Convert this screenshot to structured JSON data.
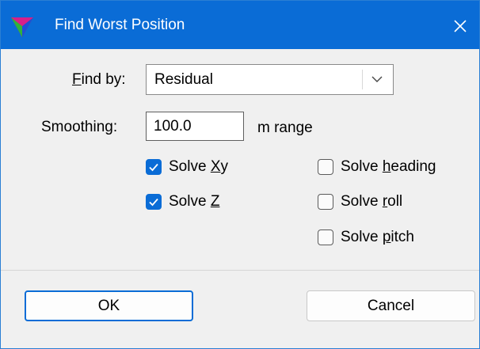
{
  "window": {
    "title": "Find Worst Position",
    "close_glyph": "✕"
  },
  "find_by": {
    "label": "Find by:",
    "mnemonic": "F",
    "label_rest": "ind by:",
    "selected": "Residual"
  },
  "smoothing": {
    "label": "Smoothing:",
    "value": "100.0",
    "unit": "m range"
  },
  "checkboxes": [
    {
      "label": "Solve Xy",
      "pre": "Solve ",
      "mnemonic": "X",
      "post": "y",
      "checked": true
    },
    {
      "label": "Solve Z",
      "pre": "Solve ",
      "mnemonic": "Z",
      "post": "",
      "checked": true
    },
    {
      "label": "Solve heading",
      "pre": "Solve ",
      "mnemonic": "h",
      "post": "eading",
      "checked": false
    },
    {
      "label": "Solve roll",
      "pre": "Solve ",
      "mnemonic": "r",
      "post": "oll",
      "checked": false
    },
    {
      "label": "Solve pitch",
      "pre": "Solve ",
      "mnemonic": "p",
      "post": "itch",
      "checked": false
    }
  ],
  "buttons": {
    "ok": "OK",
    "cancel": "Cancel"
  },
  "colors": {
    "titlebar": "#0a6cd6",
    "accent": "#0a6cd6",
    "dialog_bg": "#f0f0f0"
  },
  "icons": {
    "app": "tri-color-arrow-icon",
    "close": "close-icon",
    "dropdown": "chevron-down-icon",
    "check": "checkmark-icon"
  }
}
